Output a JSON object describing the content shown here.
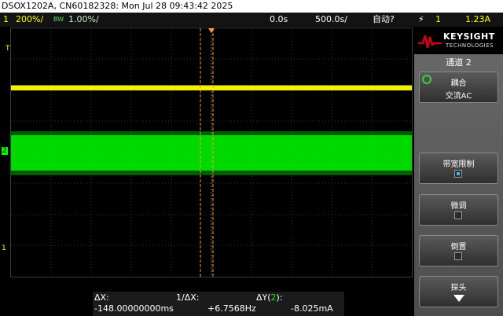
{
  "header": {
    "title": "DSOX1202A, CN60182328: Mon Jul 28 09:43:42 2025"
  },
  "topbar": {
    "ch1_num": "1",
    "ch1_scale": "200%/",
    "bw_icon": "BW",
    "bw_value": "1.00%/",
    "time_delay": "0.0s",
    "time_scale": "500.0s/",
    "trigger_mode": "自动?",
    "trigger_symbol": "⚡",
    "trigger_source": "1",
    "trigger_level": "1.23A"
  },
  "markers": {
    "t_marker": "T",
    "ch2_marker": "2",
    "ch1_marker": "1",
    "trigger_marker": "▼"
  },
  "panel": {
    "brand": "KEYSIGHT",
    "brand_sub": "TECHNOLOGIES",
    "title": "通道 2",
    "softkeys": [
      {
        "line1": "耦合",
        "line2": "交流AC",
        "icon": "rotate-knob-icon"
      },
      {
        "line1": "带宽限制",
        "checked": true
      },
      {
        "line1": "微调",
        "checked": false
      },
      {
        "line1": "倒置",
        "checked": false
      },
      {
        "line1": "探头",
        "icon": "down-arrow-icon"
      }
    ]
  },
  "measurements": {
    "dx_label": "ΔX:",
    "dx_value": "-148.00000000ms",
    "inv_dx_label": "1/ΔX:",
    "inv_dx_value": "+6.7568Hz",
    "dy_label_prefix": "ΔY(",
    "dy_channel": "2",
    "dy_label_suffix": "):",
    "dy_value": "-8.025mA"
  },
  "colors": {
    "ch1": "#ffff00",
    "ch2": "#00ff00",
    "cursor": "#ff9a2e",
    "grid": "#3a3a3a",
    "keysight_red": "#d0021b",
    "softkey_accent": "#3ab6ff"
  }
}
